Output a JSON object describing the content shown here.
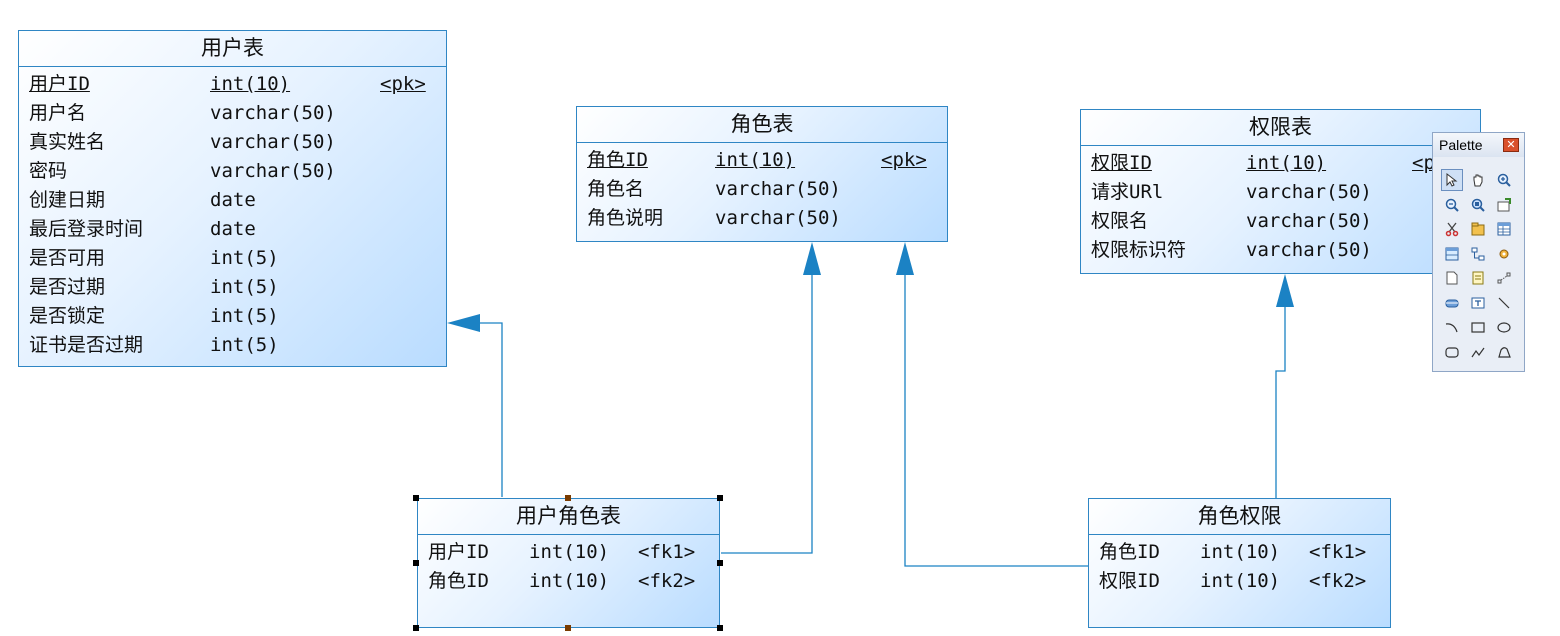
{
  "entities": {
    "user": {
      "title": "用户表",
      "rows": [
        {
          "name": "用户ID",
          "type": "int(10)",
          "key": "<pk>"
        },
        {
          "name": "用户名",
          "type": "varchar(50)",
          "key": ""
        },
        {
          "name": "真实姓名",
          "type": "varchar(50)",
          "key": ""
        },
        {
          "name": "密码",
          "type": "varchar(50)",
          "key": ""
        },
        {
          "name": "创建日期",
          "type": "date",
          "key": ""
        },
        {
          "name": "最后登录时间",
          "type": "date",
          "key": ""
        },
        {
          "name": "是否可用",
          "type": "int(5)",
          "key": ""
        },
        {
          "name": "是否过期",
          "type": "int(5)",
          "key": ""
        },
        {
          "name": "是否锁定",
          "type": "int(5)",
          "key": ""
        },
        {
          "name": "证书是否过期",
          "type": "int(5)",
          "key": ""
        }
      ]
    },
    "role": {
      "title": "角色表",
      "rows": [
        {
          "name": "角色ID",
          "type": "int(10)",
          "key": "<pk>"
        },
        {
          "name": "角色名",
          "type": "varchar(50)",
          "key": ""
        },
        {
          "name": "角色说明",
          "type": "varchar(50)",
          "key": ""
        }
      ]
    },
    "permission": {
      "title": "权限表",
      "rows": [
        {
          "name": "权限ID",
          "type": "int(10)",
          "key": "<pk>"
        },
        {
          "name": "请求URl",
          "type": "varchar(50)",
          "key": ""
        },
        {
          "name": "权限名",
          "type": "varchar(50)",
          "key": ""
        },
        {
          "name": "权限标识符",
          "type": "varchar(50)",
          "key": ""
        }
      ]
    },
    "user_role": {
      "title": "用户角色表",
      "rows": [
        {
          "name": "用户ID",
          "type": "int(10)",
          "key": "<fk1>"
        },
        {
          "name": "角色ID",
          "type": "int(10)",
          "key": "<fk2>"
        }
      ]
    },
    "role_permission": {
      "title": "角色权限",
      "rows": [
        {
          "name": "角色ID",
          "type": "int(10)",
          "key": "<fk1>"
        },
        {
          "name": "权限ID",
          "type": "int(10)",
          "key": "<fk2>"
        }
      ]
    }
  },
  "palette": {
    "title": "Palette",
    "close_glyph": "✕",
    "tools": [
      "pointer-icon",
      "hand-icon",
      "zoom-in-icon",
      "zoom-out-icon",
      "zoom-fit-icon",
      "properties-icon",
      "cut-icon",
      "package-icon",
      "table-icon",
      "view-icon",
      "reference-icon",
      "procedure-icon",
      "file-icon",
      "note-icon",
      "link-icon",
      "storage-icon",
      "text-icon",
      "line-icon",
      "arc-icon",
      "rectangle-icon",
      "ellipse-icon",
      "rounded-rectangle-icon",
      "polyline-icon",
      "polygon-icon"
    ]
  },
  "colors": {
    "border": "#2f86c4",
    "connector": "#1b82c4",
    "gradient_start": "#ffffff",
    "gradient_end": "#b9dcff"
  }
}
